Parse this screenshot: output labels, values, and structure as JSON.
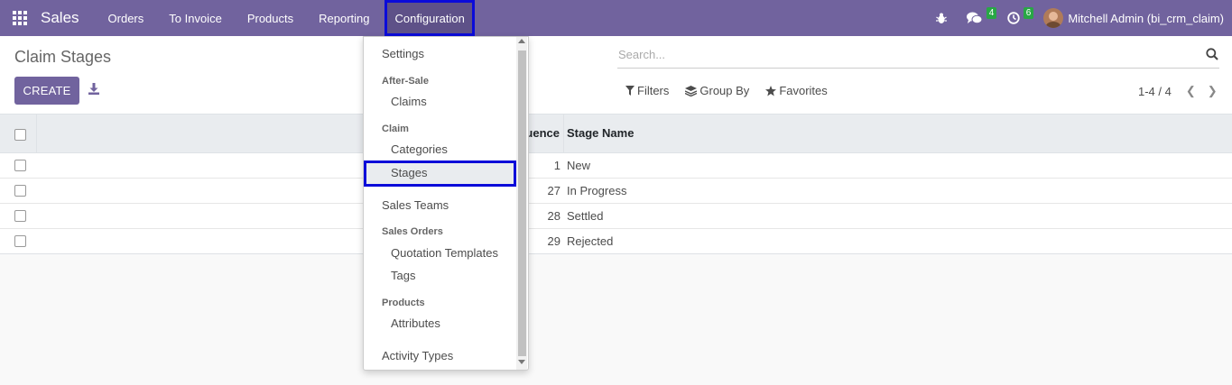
{
  "app": {
    "title": "Sales"
  },
  "nav": {
    "menu": [
      "Orders",
      "To Invoice",
      "Products",
      "Reporting",
      "Configuration"
    ],
    "messages_count": "4",
    "activities_count": "6",
    "user": "Mitchell Admin (bi_crm_claim)"
  },
  "control_panel": {
    "title": "Claim Stages",
    "create_label": "CREATE",
    "search_placeholder": "Search...",
    "filters_label": "Filters",
    "group_by_label": "Group By",
    "favorites_label": "Favorites",
    "pager": "1-4 / 4"
  },
  "list": {
    "columns": [
      "uence",
      "Stage Name"
    ],
    "rows": [
      {
        "sequence": "1",
        "stage_name": "New"
      },
      {
        "sequence": "27",
        "stage_name": "In Progress"
      },
      {
        "sequence": "28",
        "stage_name": "Settled"
      },
      {
        "sequence": "29",
        "stage_name": "Rejected"
      }
    ]
  },
  "dropdown": {
    "settings": "Settings",
    "after_sale_header": "After-Sale",
    "claims": "Claims",
    "claim_header": "Claim",
    "categories": "Categories",
    "stages": "Stages",
    "sales_teams": "Sales Teams",
    "sales_orders_header": "Sales Orders",
    "quotation_templates": "Quotation Templates",
    "tags": "Tags",
    "products_header": "Products",
    "attributes": "Attributes",
    "activity_types": "Activity Types"
  },
  "colors": {
    "brand": "#71639e",
    "highlight_outline": "#0b0bd9",
    "badge": "#28a745"
  }
}
